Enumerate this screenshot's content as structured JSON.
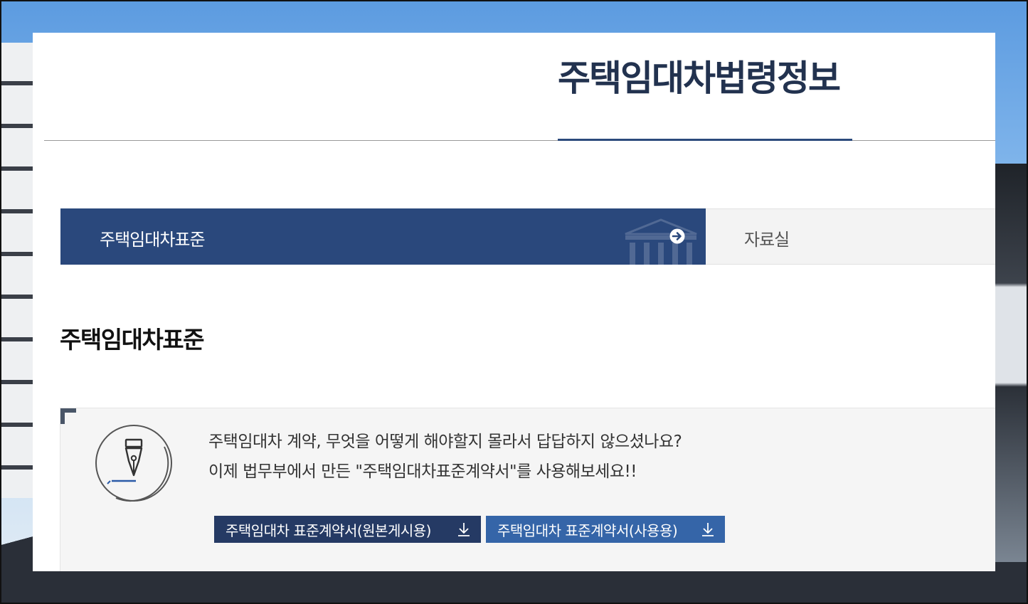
{
  "header": {
    "title": "주택임대차법령정보"
  },
  "tabs": [
    {
      "label": "주택임대차표준",
      "active": true,
      "icon": "arrow-right-circle-icon"
    },
    {
      "label": "자료실",
      "active": false
    }
  ],
  "section": {
    "heading": "주택임대차표준"
  },
  "info": {
    "icon": "fountain-pen-icon",
    "line1": "주택임대차 계약, 무엇을 어떻게 해야할지 몰라서 답답하지 않으셨나요?",
    "line2": "이제 법무부에서 만든 \"주택임대차표준계약서\"를 사용해보세요!!"
  },
  "downloads": [
    {
      "label": "주택임대차 표준계약서(원본게시용)",
      "icon": "download-icon"
    },
    {
      "label": "주택임대차 표준계약서(사용용)",
      "icon": "download-icon"
    }
  ],
  "colors": {
    "title": "#22324f",
    "tab_active_bg": "#2a487c",
    "btn_original_bg": "#253a64",
    "btn_use_bg": "#3565a8"
  }
}
